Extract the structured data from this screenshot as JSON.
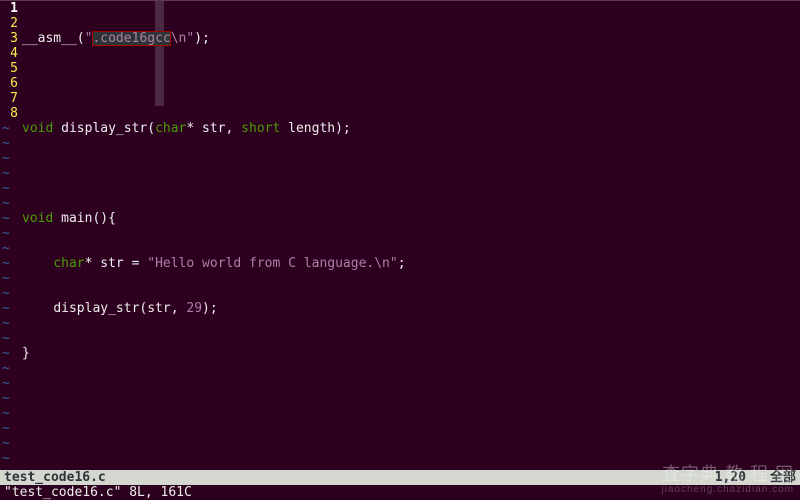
{
  "file": {
    "name": "test_code16.c",
    "message": "\"test_code16.c\" 8L, 161C"
  },
  "cursor": {
    "line": 1,
    "col": 20,
    "display": "1,20"
  },
  "scroll": {
    "percent": "全部"
  },
  "code": {
    "l1": {
      "asm": "__asm__",
      "openp": "(",
      "q1": "\"",
      "hl": ".code16gcc",
      "esc": "\\n",
      "q2": "\"",
      "closep": ");"
    },
    "l3": {
      "ret": "void",
      "name": "display_str",
      "arg1t": "char",
      "arg1n": "* str, ",
      "arg2t": "short",
      "arg2n": " length);"
    },
    "l5": {
      "ret": "void",
      "name": "main",
      "sig": "(){"
    },
    "l6": {
      "indent": "    ",
      "type": "char",
      "decl": "* str = ",
      "q1": "\"",
      "text": "Hello world from C language.",
      "esc": "\\n",
      "q2": "\"",
      "tail": ";"
    },
    "l7": {
      "indent": "    ",
      "call": "display_str(str, ",
      "num": "29",
      "tail": ");"
    },
    "l8": {
      "brace": "}"
    }
  },
  "gutter": [
    "1",
    "2",
    "3",
    "4",
    "5",
    "6",
    "7",
    "8"
  ],
  "tilde": "~",
  "watermark": {
    "big": "查字典  教 程 网",
    "small": "jiaocheng.chazidian.com"
  }
}
